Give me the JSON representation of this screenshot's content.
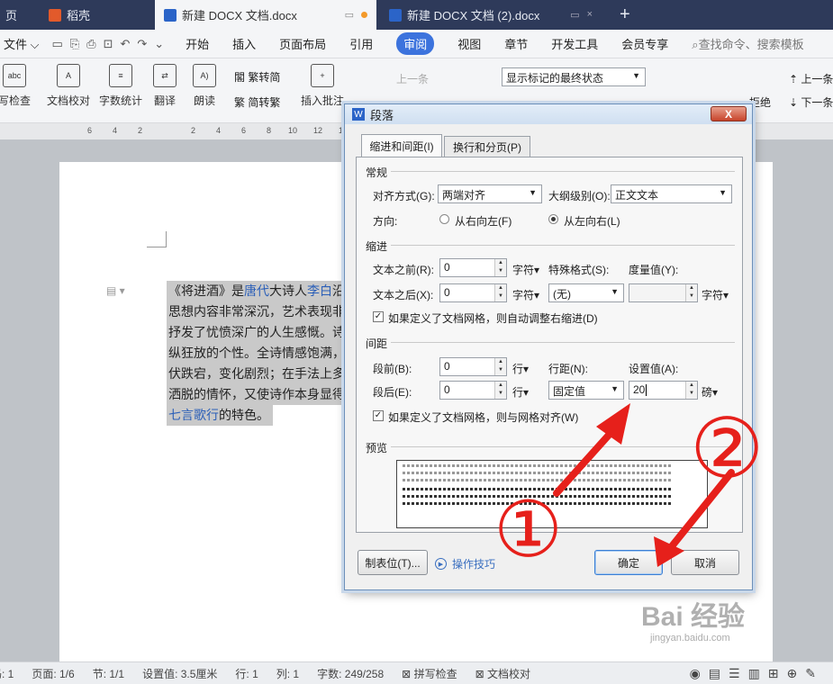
{
  "tabs": [
    {
      "label": "页"
    },
    {
      "label": "稻壳"
    },
    {
      "label": "新建 DOCX 文档.docx"
    },
    {
      "label": "新建 DOCX 文档 (2).docx"
    },
    {
      "label": "+"
    }
  ],
  "menu": {
    "file": "文件",
    "items": [
      "开始",
      "插入",
      "页面布局",
      "引用",
      "审阅",
      "视图",
      "章节",
      "开发工具",
      "会员专享"
    ],
    "search_placeholder": "查找命令、搜索模板"
  },
  "ribbon": {
    "spell": "写检查",
    "proof": "文档校对",
    "wordcount": "字数统计",
    "translate": "翻译",
    "read": "朗读",
    "t2s": "繁转简",
    "s2t": "简转繁",
    "insert_comment": "插入批注",
    "prev_comment": "上一条",
    "markup_state": "显示标记的最终状态",
    "prev": "上一条",
    "next": "下一条",
    "reject": "拒绝"
  },
  "ruler": [
    "6",
    "4",
    "2",
    "2",
    "4",
    "6",
    "8",
    "10",
    "12",
    "14",
    "16",
    "18"
  ],
  "document": {
    "lines": [
      [
        "《将进酒》是",
        "唐代",
        "大诗人",
        "李白",
        "沿"
      ],
      [
        "思想内容非常深沉，艺术表现非"
      ],
      [
        "抒发了忧愤深广的人生感慨。诗"
      ],
      [
        "纵狂放的个性。全诗情感饱满，"
      ],
      [
        "伏跌宕，变化剧烈；在手法上多"
      ],
      [
        "洒脱的情怀，又使诗作本身显得"
      ],
      [
        "七言歌行",
        "的特色。"
      ]
    ]
  },
  "dialog": {
    "title": "段落",
    "close": "X",
    "tab_indent": "缩进和间距(I)",
    "tab_break": "换行和分页(P)",
    "general": "常规",
    "align_label": "对齐方式(G):",
    "align_value": "两端对齐",
    "outline_label": "大纲级别(O):",
    "outline_value": "正文文本",
    "direction_label": "方向:",
    "rtl": "从右向左(F)",
    "ltr": "从左向右(L)",
    "indent": "缩进",
    "before_text": "文本之前(R):",
    "before_text_value": "0",
    "after_text": "文本之后(X):",
    "after_text_value": "0",
    "unit_char": "字符▾",
    "special_label": "特殊格式(S):",
    "special_value": "(无)",
    "measure_label": "度量值(Y):",
    "measure_value": "",
    "auto_adjust": "如果定义了文档网格，则自动调整右缩进(D)",
    "spacing": "间距",
    "before_para": "段前(B):",
    "before_para_value": "0",
    "after_para": "段后(E):",
    "after_para_value": "0",
    "unit_line": "行▾",
    "line_spacing_label": "行距(N):",
    "line_spacing_value": "固定值",
    "set_value_label": "设置值(A):",
    "set_value": "20",
    "unit_pound": "磅▾",
    "grid_align": "如果定义了文档网格，则与网格对齐(W)",
    "preview": "预览",
    "tabs_button": "制表位(T)...",
    "tips": "操作技巧",
    "ok": "确定",
    "cancel": "取消"
  },
  "annotations": {
    "one": "①",
    "two": "②"
  },
  "status": {
    "page": "页码: 1",
    "pages": "页面: 1/6",
    "section": "节: 1/1",
    "setting": "设置值: 3.5厘米",
    "row": "行: 1",
    "col": "列: 1",
    "words": "字数: 249/258",
    "spell": "拼写检查",
    "proof": "文档校对"
  },
  "watermark": {
    "logo": "Bai 经验",
    "url": "jingyan.baidu.com"
  },
  "colors": {
    "accent": "#3c73dd",
    "annotation_red": "#e6201b",
    "link_blue": "#2b5fb8"
  }
}
